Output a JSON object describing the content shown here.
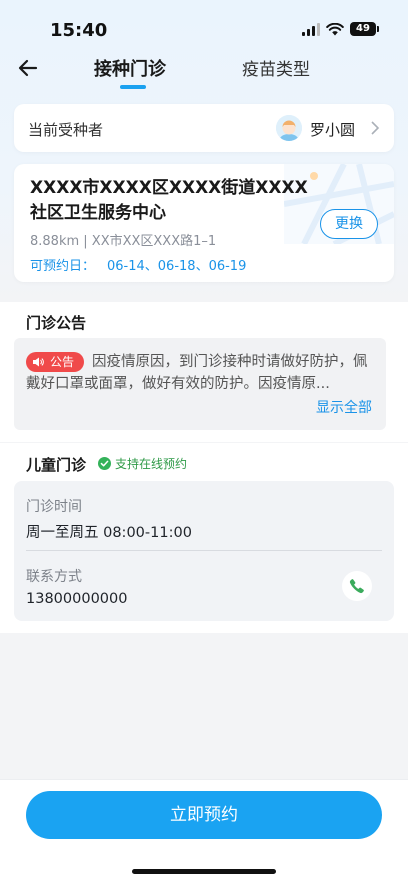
{
  "status_bar": {
    "time": "15:40",
    "battery": "49"
  },
  "nav": {
    "tabs": [
      {
        "label": "接种门诊"
      },
      {
        "label": "疫苗类型"
      }
    ]
  },
  "recipient": {
    "label": "当前受种者",
    "name": "罗小圆"
  },
  "clinic": {
    "name": "XXXX市XXXX区XXXX街道XXXX社区卫生服务中心",
    "distance_address": "8.88km | XX市XX区XXX路1–1",
    "available_label": "可预约日：",
    "available_dates": "06-14、06-18、06-19",
    "change_button": "更换"
  },
  "notice": {
    "title": "门诊公告",
    "tag": "公告",
    "text": "因疫情原因，到门诊接种时请做好防护，佩戴好口罩或面罩，做好有效的防护。因疫情原...",
    "show_all": "显示全部"
  },
  "pediatric": {
    "title": "儿童门诊",
    "badge": "支持在线预约",
    "hours_label": "门诊时间",
    "hours_value": "周一至周五 08:00-11:00",
    "contact_label": "联系方式",
    "contact_value": "13800000000"
  },
  "footer": {
    "cta": "立即预约"
  },
  "colors": {
    "accent": "#1aa3f2",
    "notice_tag": "#f04a4a",
    "success": "#2f9a48"
  }
}
